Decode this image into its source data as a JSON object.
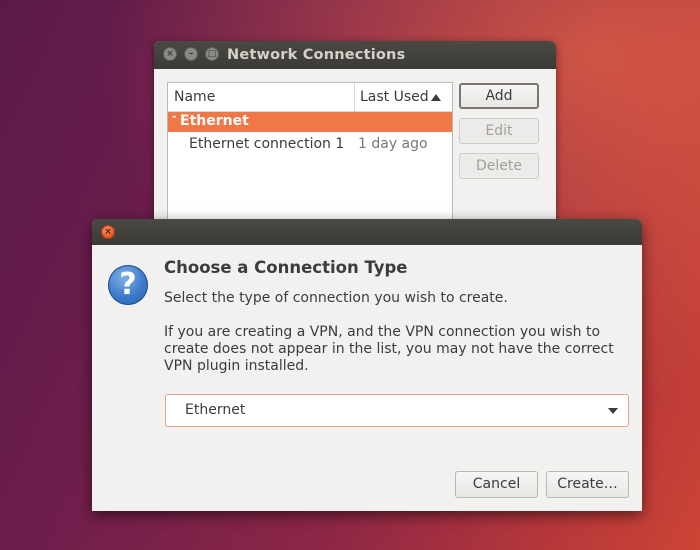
{
  "background_window": {
    "title": "Network Connections",
    "list": {
      "columns": [
        "Name",
        "Last Used"
      ],
      "sort_indicator": "sort-ascending-icon",
      "group": {
        "label": "Ethernet",
        "expander": "-"
      },
      "rows": [
        {
          "name": "Ethernet connection 1",
          "last_used": "1 day ago"
        }
      ]
    },
    "buttons": {
      "add": "Add",
      "edit": "Edit",
      "delete": "Delete"
    }
  },
  "dialog": {
    "heading": "Choose a Connection Type",
    "subtitle": "Select the type of connection you wish to create.",
    "body": "If you are creating a VPN, and the VPN connection you wish to create does not appear in the list, you may not have the correct VPN plugin installed.",
    "connection_type": {
      "selected": "Ethernet"
    },
    "buttons": {
      "cancel": "Cancel",
      "create": "Create…"
    }
  },
  "colors": {
    "accent": "#f07746",
    "close_button": "#e95420",
    "titlebar": "#3c3b37"
  }
}
